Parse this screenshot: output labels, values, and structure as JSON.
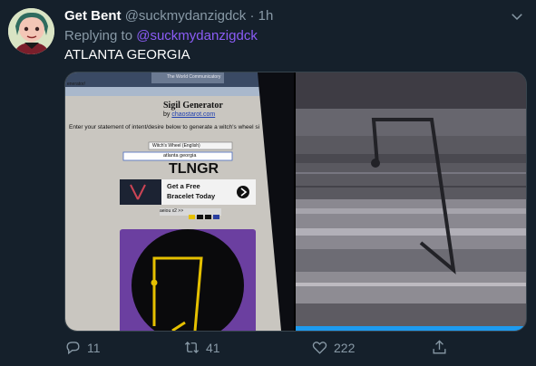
{
  "tweet": {
    "display_name": "Get Bent",
    "handle": "@suckmydanzigdck",
    "separator": "·",
    "time": "1h",
    "replying_prefix": "Replying to ",
    "replying_to": "@suckmydanzigdck",
    "text": "ATLANTA GEORGIA"
  },
  "screen_photo": {
    "url_fragment": "enerator/",
    "tab_title": "The World Communicatory",
    "page_title": "Sigil Generator",
    "byline_prefix": "by",
    "byline_link": "chaostarot.com",
    "instructions": "Enter your statement of intent/desire below to generate a witch's wheel si",
    "select_value": "Witch's Wheel (English)",
    "input_value": "atlanta georgia",
    "result_letters": "TLNGR",
    "ad_line1": "Get a Free",
    "ad_line2": "Bracelet Today",
    "options_row": "aeiou  x2  >>"
  },
  "actions": {
    "replies": "11",
    "retweets": "41",
    "likes": "222"
  },
  "colors": {
    "background": "#15202b",
    "secondary_text": "#8899a6",
    "mention": "#8b5cf6",
    "accent": "#1d9bf0"
  },
  "icons": [
    "avatar",
    "chevron-down-icon",
    "reply-icon",
    "retweet-icon",
    "like-icon",
    "share-icon"
  ]
}
